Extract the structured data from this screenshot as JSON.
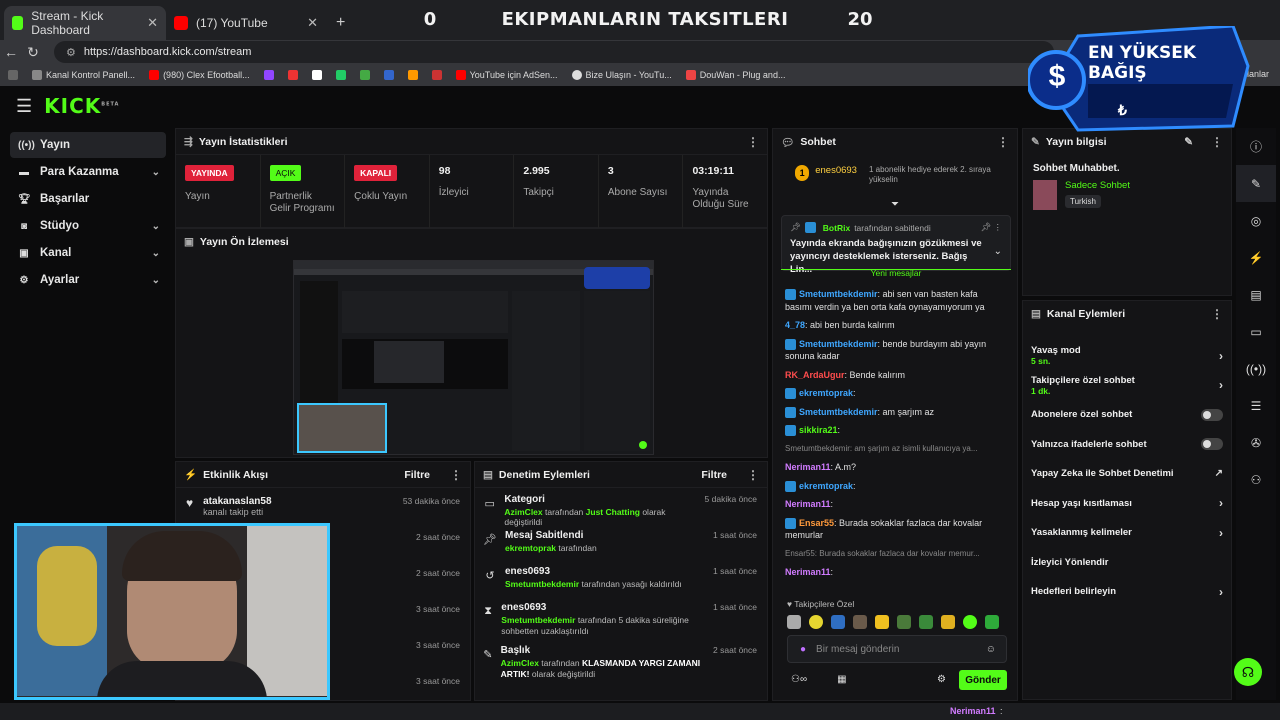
{
  "browser": {
    "tabs": [
      {
        "title": "Stream - Kick Dashboard",
        "active": true
      },
      {
        "title": "(17) YouTube",
        "active": false
      }
    ],
    "new_tab": "+",
    "url": "https://dashboard.kick.com/stream",
    "bookmarks": [
      "Kanal Kontrol Panell...",
      "(980) Clex Efootball...",
      "YouTube için AdSen...",
      "Bize Ulaşın - YouTu...",
      "DouWan - Plug and..."
    ],
    "bookmarks_right": "ulanlar"
  },
  "scoreboard": {
    "left": "0",
    "title": "EKIPMANLARIN TAKSITLERI",
    "right": "20"
  },
  "donation": {
    "title": "EN YÜKSEK BAĞIŞ",
    "currency": "₺",
    "dollar": "$"
  },
  "kick": {
    "logo": "KICK",
    "beta": "BETA"
  },
  "sidebar": {
    "items": [
      {
        "label": "Yayın",
        "icon": "broadcast-icon",
        "active": true,
        "chev": false
      },
      {
        "label": "Para Kazanma",
        "icon": "money-icon",
        "active": false,
        "chev": true
      },
      {
        "label": "Başarılar",
        "icon": "trophy-icon",
        "active": false,
        "chev": false
      },
      {
        "label": "Stüdyo",
        "icon": "studio-icon",
        "active": false,
        "chev": true
      },
      {
        "label": "Kanal",
        "icon": "channel-icon",
        "active": false,
        "chev": true
      },
      {
        "label": "Ayarlar",
        "icon": "gear-icon",
        "active": false,
        "chev": true
      }
    ]
  },
  "stats": {
    "title": "Yayın İstatistikleri",
    "cells": [
      {
        "badge": "YAYINDA",
        "badge_color": "#e0223a",
        "label": "Yayın"
      },
      {
        "badge": "AÇIK",
        "badge_color": "#53fc18",
        "label": "Partnerlik Gelir Programı"
      },
      {
        "badge": "KAPALI",
        "badge_color": "#e0223a",
        "label": "Çoklu Yayın"
      },
      {
        "value": "98",
        "label": "İzleyici"
      },
      {
        "value": "2.995",
        "label": "Takipçi"
      },
      {
        "value": "3",
        "label": "Abone Sayısı"
      },
      {
        "value": "03:19:11",
        "label": "Yayında Olduğu Süre"
      }
    ]
  },
  "preview": {
    "title": "Yayın Ön İzlemesi"
  },
  "activity": {
    "title": "Etkinlik Akışı",
    "filter": "Filtre",
    "rows": [
      {
        "name": "atakanaslan58",
        "desc": "kanalı takip etti",
        "time": "53 dakika önce"
      },
      {
        "name": "",
        "desc": "",
        "time": "2 saat önce"
      },
      {
        "name": "",
        "desc": "",
        "time": "2 saat önce"
      },
      {
        "name": "",
        "desc": "",
        "time": "3 saat önce"
      },
      {
        "name": "",
        "desc": "",
        "time": "3 saat önce"
      },
      {
        "name": "",
        "desc": "",
        "time": "3 saat önce"
      }
    ]
  },
  "moderation": {
    "title": "Denetim Eylemleri",
    "filter": "Filtre",
    "rows": [
      {
        "icon": "category-icon",
        "title": "Kategori",
        "actor": "AzimClex",
        "mid": " tarafından ",
        "g2": "Just Chatting",
        "rest": " olarak değiştirildi",
        "time": "5 dakika önce"
      },
      {
        "icon": "pin-icon",
        "title": "Mesaj Sabitlendi",
        "actor": "ekremtoprak",
        "mid": " tarafından",
        "g2": "",
        "rest": "",
        "time": "1 saat önce"
      },
      {
        "icon": "unban-icon",
        "title": "enes0693",
        "actor": "Smetumtbekdemir",
        "mid": " tarafından yasağı kaldırıldı",
        "g2": "",
        "rest": "",
        "time": "1 saat önce"
      },
      {
        "icon": "timeout-icon",
        "title": "enes0693",
        "actor": "Smetumtbekdemir",
        "mid": " tarafından 5 dakika süreliğine sohbetten uzaklaştırıldı",
        "g2": "",
        "rest": "",
        "time": "1 saat önce"
      },
      {
        "icon": "title-icon",
        "title": "Başlık",
        "actor": "AzimClex",
        "mid": " tarafından ",
        "g2": "KLASMANDA YARGI ZAMANI ARTIK!",
        "rest": " olarak değiştirildi",
        "time": "2 saat önce"
      }
    ]
  },
  "chat": {
    "title": "Sohbet",
    "gift_user": "enes0693",
    "gift_count": "1",
    "gift_text": "1 abonelik hediye ederek 2. sıraya yükselin",
    "pinned_by": "BotRix",
    "pinned_suffix": "tarafından sabitlendi",
    "pinned_text": "Yayında ekranda bağışınızın gözükmesi ve yayıncıyı desteklemek isterseniz. Bağış Lin...",
    "new_messages": "Yeni mesajlar",
    "messages": [
      {
        "user": "Smetumtbekdemir",
        "color": "#3fa7ff",
        "text": ": abi sen van basten kafa basımı verdin ya ben orta kafa oynayamıyorum ya",
        "kick": true
      },
      {
        "user": "4_78",
        "color": "#3fa7ff",
        "text": ": abi ben burda kalırım",
        "kick": false
      },
      {
        "user": "Smetumtbekdemir",
        "color": "#3fa7ff",
        "text": ": bende burdayım abi yayın sonuna kadar",
        "kick": true
      },
      {
        "user": "RK_ArdaUgur",
        "color": "#ff4d4d",
        "text": ": Bende kalırım",
        "kick": false
      },
      {
        "user": "ekremtoprak",
        "color": "#3fa7ff",
        "text": ":",
        "kick": true
      },
      {
        "user": "Smetumtbekdemir",
        "color": "#3fa7ff",
        "text": ": am şarjım az",
        "kick": true
      },
      {
        "user": "sikkira21",
        "color": "#53fc18",
        "text": ":",
        "kick": true
      },
      {
        "reply": "Smetumtbekdemir: am şarjım az isimli kullanıcıya ya..."
      },
      {
        "user": "Neriman11",
        "color": "#d17cff",
        "text": ": A.m?",
        "kick": false
      },
      {
        "user": "ekremtoprak",
        "color": "#3fa7ff",
        "text": ":",
        "kick": true
      },
      {
        "user": "Neriman11",
        "color": "#d17cff",
        "text": ":",
        "kick": false
      },
      {
        "user": "Ensar55",
        "color": "#ff9a3c",
        "text": ": Burada sokaklar fazlaca dar kovalar memurlar",
        "kick": true
      },
      {
        "reply": "Ensar55: Burada sokaklar fazlaca dar kovalar memur..."
      },
      {
        "user": "Neriman11",
        "color": "#d17cff",
        "text": ":",
        "kick": false
      }
    ],
    "follower_label": "Takipçilere Özel",
    "input_placeholder": "Bir mesaj gönderin",
    "send": "Gönder"
  },
  "info": {
    "title": "Yayın bilgisi",
    "stream_title": "Sohbet Muhabbet.",
    "category": "Sadece Sohbet",
    "language": "Turkish"
  },
  "actions": {
    "title": "Kanal Eylemleri",
    "items": [
      {
        "label": "Yavaş mod",
        "sub": "5 sn.",
        "type": "chev"
      },
      {
        "label": "Takipçilere özel sohbet",
        "sub": "1 dk.",
        "type": "chev"
      },
      {
        "label": "Abonelere özel sohbet",
        "sub": "",
        "type": "toggle"
      },
      {
        "label": "Yalnızca ifadelerle sohbet",
        "sub": "",
        "type": "toggle"
      },
      {
        "label": "Yapay Zeka ile Sohbet Denetimi",
        "sub": "",
        "type": "ext"
      },
      {
        "label": "Hesap yaşı kısıtlaması",
        "sub": "",
        "type": "chev"
      },
      {
        "label": "Yasaklanmış kelimeler",
        "sub": "",
        "type": "chev"
      },
      {
        "label": "İzleyici Yönlendir",
        "sub": "",
        "type": "none"
      },
      {
        "label": "Hedefleri belirleyin",
        "sub": "",
        "type": "chev"
      }
    ]
  },
  "bottombar": {
    "user": "Neriman11",
    "text": ":"
  },
  "colors": {
    "accent": "#53fc18",
    "live": "#e0223a",
    "overlay_blue": "#2f8cff"
  }
}
